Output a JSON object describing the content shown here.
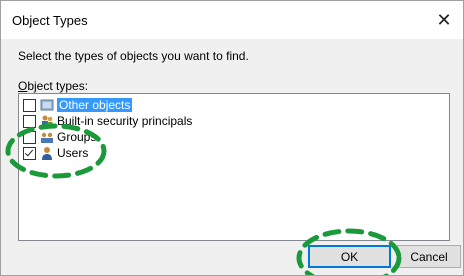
{
  "dialog": {
    "title": "Object Types",
    "close_glyph": "✕",
    "instruction": "Select the types of objects you want to find.",
    "list_label_accel": "O",
    "list_label_rest": "bject types:",
    "items": [
      {
        "label": "Other objects",
        "checked": false,
        "selected": true,
        "icon": "other-objects-icon"
      },
      {
        "label": "Built-in security principals",
        "checked": false,
        "selected": false,
        "icon": "security-principals-icon"
      },
      {
        "label": "Groups",
        "checked": false,
        "selected": false,
        "icon": "groups-icon"
      },
      {
        "label": "Users",
        "checked": true,
        "selected": false,
        "icon": "users-icon"
      }
    ],
    "ok_label": "OK",
    "cancel_label": "Cancel"
  },
  "annotation_color": "#1a9a3a"
}
